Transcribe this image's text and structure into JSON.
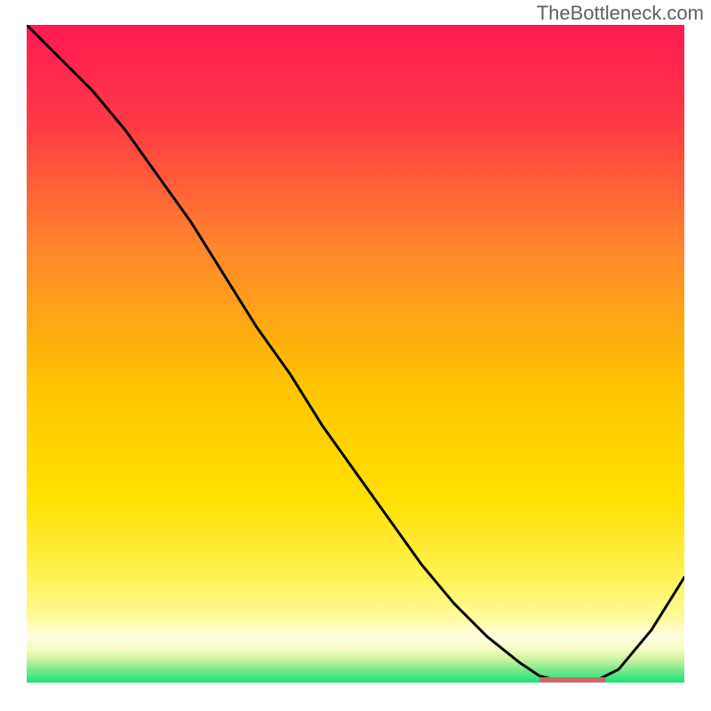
{
  "watermark": "TheBottleneck.com",
  "colors": {
    "top": "#ff1a52",
    "upper_mid": "#ff7a2a",
    "mid": "#ffd200",
    "lower_mid": "#fff77a",
    "light_band": "#fffcaa",
    "band_pale": "#fffde0",
    "green": "#19e276",
    "line": "#000000",
    "marker": "#c66b67"
  },
  "chart_data": {
    "type": "line",
    "title": "",
    "xlabel": "",
    "ylabel": "",
    "xlim": [
      0,
      100
    ],
    "ylim": [
      0,
      100
    ],
    "x": [
      0,
      5,
      10,
      15,
      20,
      25,
      30,
      35,
      40,
      45,
      50,
      55,
      60,
      65,
      70,
      75,
      78,
      82,
      86,
      90,
      95,
      100
    ],
    "values": [
      100,
      95,
      90,
      84,
      77,
      70,
      62,
      54,
      47,
      39,
      32,
      25,
      18,
      12,
      7,
      3,
      1,
      0,
      0,
      2,
      8,
      16
    ],
    "marker": {
      "x_start": 78,
      "x_end": 88,
      "y": 0
    }
  }
}
